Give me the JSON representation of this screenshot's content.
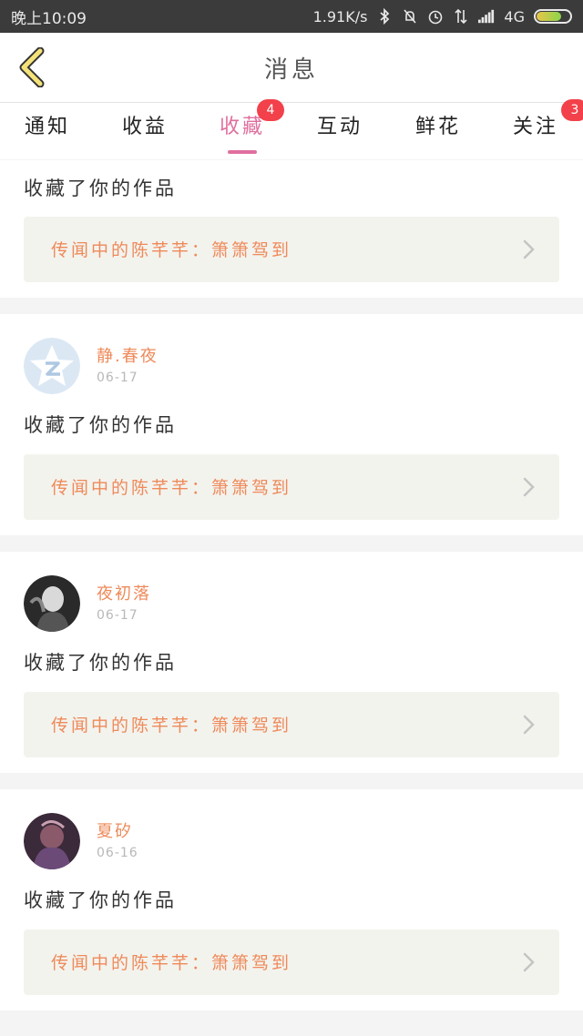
{
  "status_bar": {
    "time": "晚上10:09",
    "net_speed": "1.91K/s",
    "network": "4G",
    "icons": [
      "bluetooth-icon",
      "mute-icon",
      "alarm-icon",
      "data-icon",
      "signal-icon",
      "battery-icon"
    ],
    "battery_level": 0.7
  },
  "header": {
    "title": "消息",
    "back_icon": "chevron-left-icon"
  },
  "tabs": [
    {
      "label": "通知",
      "badge": ""
    },
    {
      "label": "收益",
      "badge": ""
    },
    {
      "label": "收藏",
      "badge": "4",
      "active": true
    },
    {
      "label": "互动",
      "badge": ""
    },
    {
      "label": "鲜花",
      "badge": ""
    },
    {
      "label": "关注",
      "badge": "3"
    }
  ],
  "colors": {
    "accent_pink": "#e06f9e",
    "name_orange": "#ee8a5a",
    "badge_red": "#f2414a"
  },
  "items": [
    {
      "user": "",
      "date": "",
      "action": "收藏了你的作品",
      "work": "传闻中的陈芊芊：箫箫驾到"
    },
    {
      "user": "静.春夜",
      "date": "06-17",
      "action": "收藏了你的作品",
      "work": "传闻中的陈芊芊：箫箫驾到"
    },
    {
      "user": "夜初落",
      "date": "06-17",
      "action": "收藏了你的作品",
      "work": "传闻中的陈芊芊：箫箫驾到"
    },
    {
      "user": "夏矽",
      "date": "06-16",
      "action": "收藏了你的作品",
      "work": "传闻中的陈芊芊：箫箫驾到"
    }
  ]
}
